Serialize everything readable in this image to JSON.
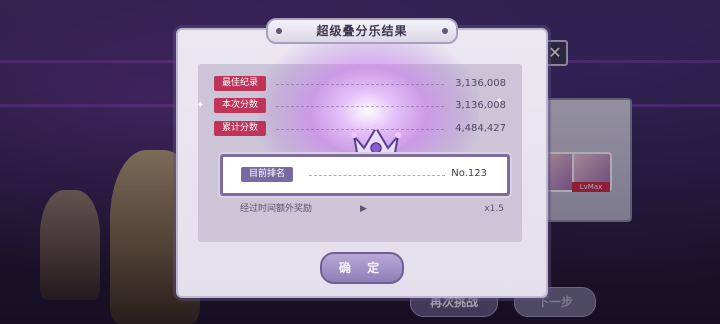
{
  "dialog": {
    "title": "超级叠分乐结果",
    "stats": [
      {
        "label": "最佳纪录",
        "value": "3,136,008"
      },
      {
        "label": "本次分数",
        "value": "3,136,008"
      },
      {
        "label": "累计分数",
        "value": "4,484,427"
      }
    ],
    "rank": {
      "label": "目前排名",
      "value": "No.123"
    },
    "bonus": {
      "label": "经过时间额外奖励",
      "arrow": "▶",
      "value": "x1.5"
    },
    "confirm_label": "确 定"
  },
  "background": {
    "close_glyph": "✕",
    "retry_label": "再次挑战",
    "next_label": "下一步",
    "level_label": "LvMax"
  },
  "colors": {
    "stat_pill": "#c0345a",
    "rank_pill": "#7a6aa4",
    "confirm_button": "#a293c9"
  }
}
